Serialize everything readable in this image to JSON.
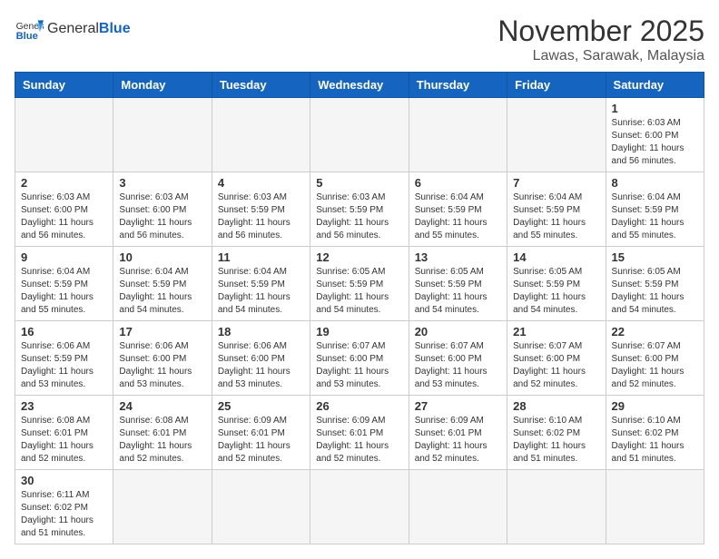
{
  "header": {
    "logo_general": "General",
    "logo_blue": "Blue",
    "month_title": "November 2025",
    "location": "Lawas, Sarawak, Malaysia"
  },
  "days_of_week": [
    "Sunday",
    "Monday",
    "Tuesday",
    "Wednesday",
    "Thursday",
    "Friday",
    "Saturday"
  ],
  "weeks": [
    [
      {
        "day": "",
        "info": ""
      },
      {
        "day": "",
        "info": ""
      },
      {
        "day": "",
        "info": ""
      },
      {
        "day": "",
        "info": ""
      },
      {
        "day": "",
        "info": ""
      },
      {
        "day": "",
        "info": ""
      },
      {
        "day": "1",
        "info": "Sunrise: 6:03 AM\nSunset: 6:00 PM\nDaylight: 11 hours\nand 56 minutes."
      }
    ],
    [
      {
        "day": "2",
        "info": "Sunrise: 6:03 AM\nSunset: 6:00 PM\nDaylight: 11 hours\nand 56 minutes."
      },
      {
        "day": "3",
        "info": "Sunrise: 6:03 AM\nSunset: 6:00 PM\nDaylight: 11 hours\nand 56 minutes."
      },
      {
        "day": "4",
        "info": "Sunrise: 6:03 AM\nSunset: 5:59 PM\nDaylight: 11 hours\nand 56 minutes."
      },
      {
        "day": "5",
        "info": "Sunrise: 6:03 AM\nSunset: 5:59 PM\nDaylight: 11 hours\nand 56 minutes."
      },
      {
        "day": "6",
        "info": "Sunrise: 6:04 AM\nSunset: 5:59 PM\nDaylight: 11 hours\nand 55 minutes."
      },
      {
        "day": "7",
        "info": "Sunrise: 6:04 AM\nSunset: 5:59 PM\nDaylight: 11 hours\nand 55 minutes."
      },
      {
        "day": "8",
        "info": "Sunrise: 6:04 AM\nSunset: 5:59 PM\nDaylight: 11 hours\nand 55 minutes."
      }
    ],
    [
      {
        "day": "9",
        "info": "Sunrise: 6:04 AM\nSunset: 5:59 PM\nDaylight: 11 hours\nand 55 minutes."
      },
      {
        "day": "10",
        "info": "Sunrise: 6:04 AM\nSunset: 5:59 PM\nDaylight: 11 hours\nand 54 minutes."
      },
      {
        "day": "11",
        "info": "Sunrise: 6:04 AM\nSunset: 5:59 PM\nDaylight: 11 hours\nand 54 minutes."
      },
      {
        "day": "12",
        "info": "Sunrise: 6:05 AM\nSunset: 5:59 PM\nDaylight: 11 hours\nand 54 minutes."
      },
      {
        "day": "13",
        "info": "Sunrise: 6:05 AM\nSunset: 5:59 PM\nDaylight: 11 hours\nand 54 minutes."
      },
      {
        "day": "14",
        "info": "Sunrise: 6:05 AM\nSunset: 5:59 PM\nDaylight: 11 hours\nand 54 minutes."
      },
      {
        "day": "15",
        "info": "Sunrise: 6:05 AM\nSunset: 5:59 PM\nDaylight: 11 hours\nand 54 minutes."
      }
    ],
    [
      {
        "day": "16",
        "info": "Sunrise: 6:06 AM\nSunset: 5:59 PM\nDaylight: 11 hours\nand 53 minutes."
      },
      {
        "day": "17",
        "info": "Sunrise: 6:06 AM\nSunset: 6:00 PM\nDaylight: 11 hours\nand 53 minutes."
      },
      {
        "day": "18",
        "info": "Sunrise: 6:06 AM\nSunset: 6:00 PM\nDaylight: 11 hours\nand 53 minutes."
      },
      {
        "day": "19",
        "info": "Sunrise: 6:07 AM\nSunset: 6:00 PM\nDaylight: 11 hours\nand 53 minutes."
      },
      {
        "day": "20",
        "info": "Sunrise: 6:07 AM\nSunset: 6:00 PM\nDaylight: 11 hours\nand 53 minutes."
      },
      {
        "day": "21",
        "info": "Sunrise: 6:07 AM\nSunset: 6:00 PM\nDaylight: 11 hours\nand 52 minutes."
      },
      {
        "day": "22",
        "info": "Sunrise: 6:07 AM\nSunset: 6:00 PM\nDaylight: 11 hours\nand 52 minutes."
      }
    ],
    [
      {
        "day": "23",
        "info": "Sunrise: 6:08 AM\nSunset: 6:01 PM\nDaylight: 11 hours\nand 52 minutes."
      },
      {
        "day": "24",
        "info": "Sunrise: 6:08 AM\nSunset: 6:01 PM\nDaylight: 11 hours\nand 52 minutes."
      },
      {
        "day": "25",
        "info": "Sunrise: 6:09 AM\nSunset: 6:01 PM\nDaylight: 11 hours\nand 52 minutes."
      },
      {
        "day": "26",
        "info": "Sunrise: 6:09 AM\nSunset: 6:01 PM\nDaylight: 11 hours\nand 52 minutes."
      },
      {
        "day": "27",
        "info": "Sunrise: 6:09 AM\nSunset: 6:01 PM\nDaylight: 11 hours\nand 52 minutes."
      },
      {
        "day": "28",
        "info": "Sunrise: 6:10 AM\nSunset: 6:02 PM\nDaylight: 11 hours\nand 51 minutes."
      },
      {
        "day": "29",
        "info": "Sunrise: 6:10 AM\nSunset: 6:02 PM\nDaylight: 11 hours\nand 51 minutes."
      }
    ],
    [
      {
        "day": "30",
        "info": "Sunrise: 6:11 AM\nSunset: 6:02 PM\nDaylight: 11 hours\nand 51 minutes."
      },
      {
        "day": "",
        "info": ""
      },
      {
        "day": "",
        "info": ""
      },
      {
        "day": "",
        "info": ""
      },
      {
        "day": "",
        "info": ""
      },
      {
        "day": "",
        "info": ""
      },
      {
        "day": "",
        "info": ""
      }
    ]
  ]
}
